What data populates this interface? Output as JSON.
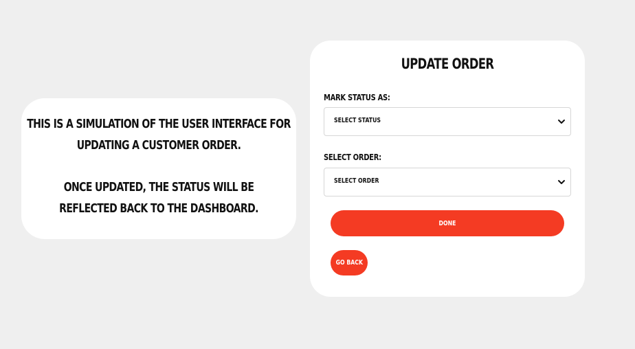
{
  "info_card": {
    "line1": "This is a simulation of the user interface for",
    "line2": "updating a customer order.",
    "line3": "Once updated, the status will be",
    "line4": "reflected back to the dashboard."
  },
  "form": {
    "title": "Update Order",
    "status_label": "Mark Status As:",
    "status_select_value": "Select Status",
    "order_label": "Select Order:",
    "order_select_value": "Select Order",
    "done_label": "Done",
    "back_label": "Go Back"
  },
  "colors": {
    "background": "#efefef",
    "card": "#ffffff",
    "accent": "#f43b23",
    "text": "#111111"
  },
  "icons": {
    "select_arrow": "chevron-down-icon"
  }
}
